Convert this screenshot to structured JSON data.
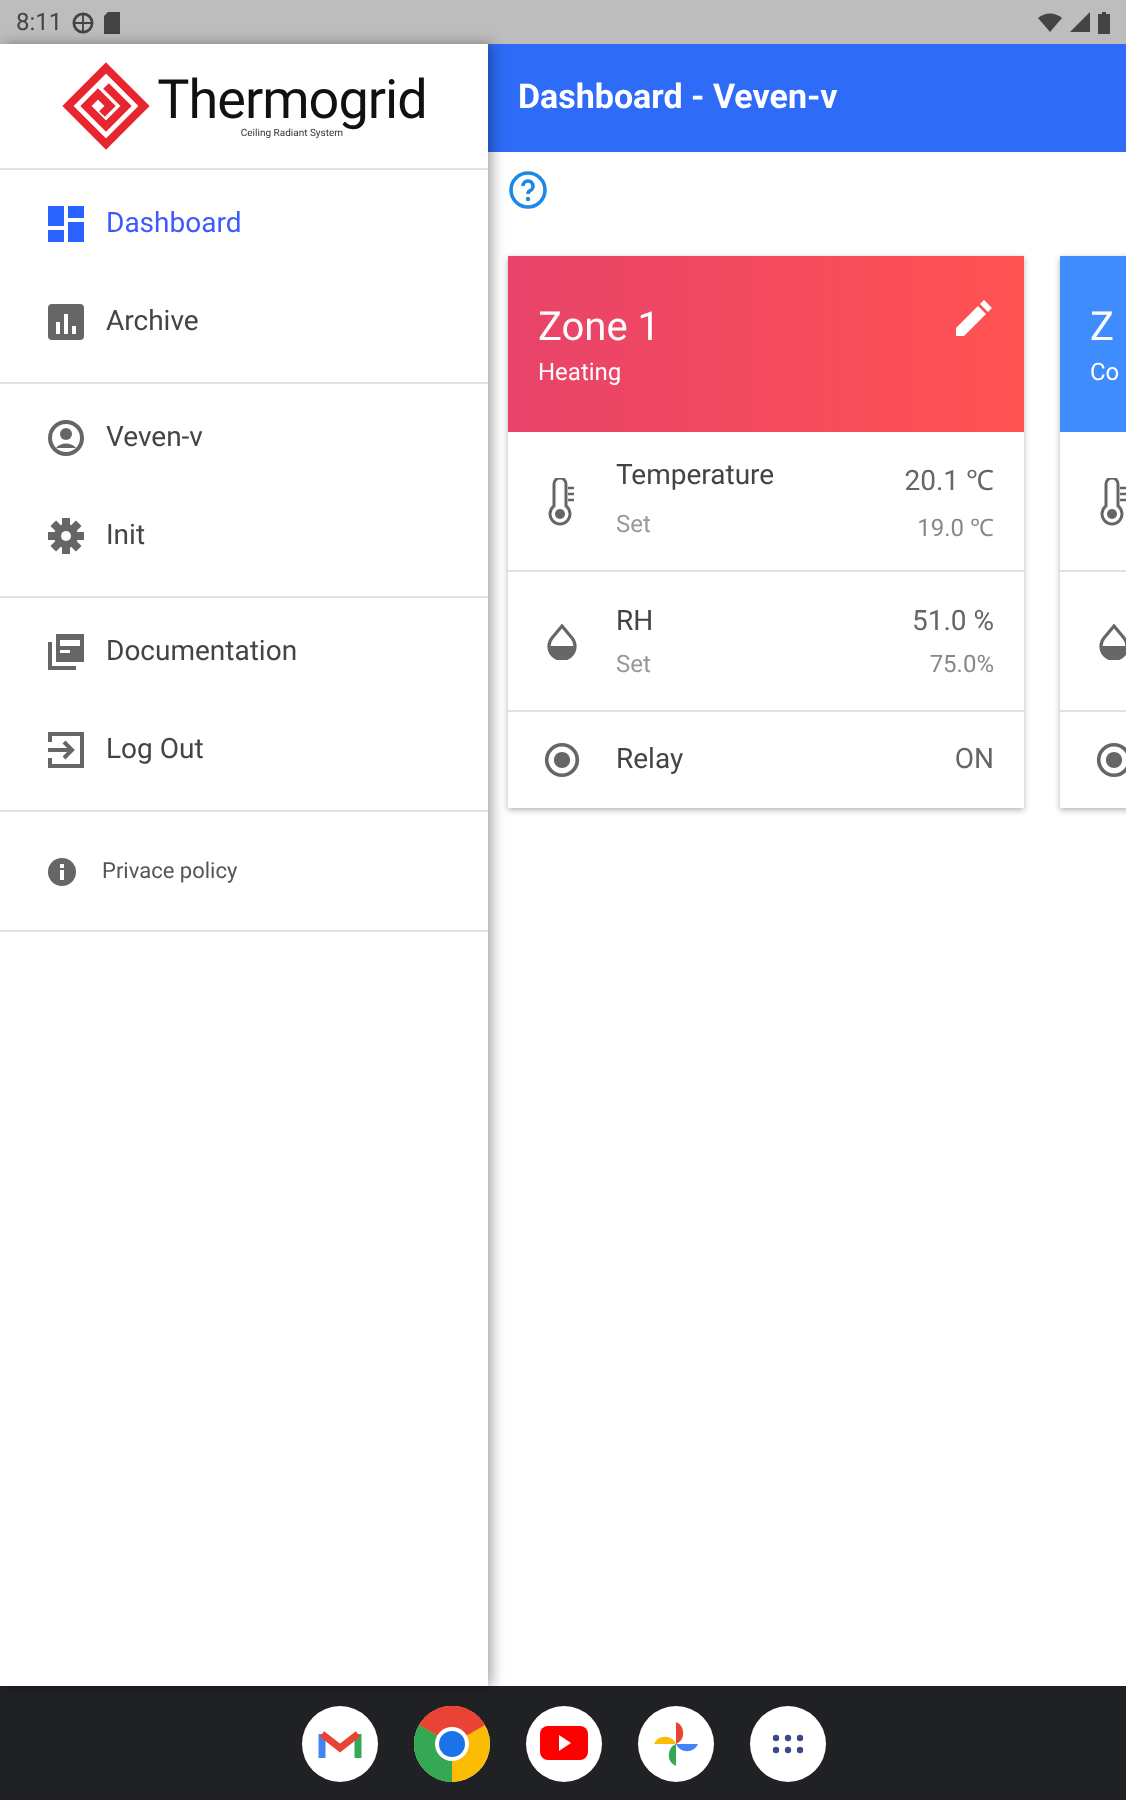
{
  "status_bar": {
    "time": "8:11"
  },
  "drawer": {
    "logo": {
      "name": "Thermogrid",
      "tagline": "Ceiling Radiant System"
    },
    "sections": [
      [
        {
          "label": "Dashboard",
          "selected": true
        },
        {
          "label": "Archive",
          "selected": false
        }
      ],
      [
        {
          "label": "Veven-v",
          "selected": false
        },
        {
          "label": "Init",
          "selected": false
        }
      ],
      [
        {
          "label": "Documentation",
          "selected": false
        },
        {
          "label": "Log Out",
          "selected": false
        }
      ]
    ],
    "footer_link": "Privace policy"
  },
  "app_bar": {
    "title": "Dashboard - Veven-v"
  },
  "zones": [
    {
      "title": "Zone 1",
      "mode": "Heating",
      "kind": "heating",
      "editable": true,
      "rows": [
        {
          "kind": "reading",
          "label": "Temperature",
          "value": "20.1 ℃",
          "sub_label": "Set",
          "sub_value": "19.0 ℃"
        },
        {
          "kind": "reading",
          "label": "RH",
          "value": "51.0 %",
          "sub_label": "Set",
          "sub_value": "75.0%"
        },
        {
          "kind": "status",
          "label": "Relay",
          "value": "ON"
        }
      ]
    },
    {
      "title": "Z",
      "mode": "Co",
      "kind": "cooling",
      "rows": [
        {
          "kind": "reading"
        },
        {
          "kind": "reading"
        },
        {
          "kind": "status"
        }
      ]
    }
  ]
}
